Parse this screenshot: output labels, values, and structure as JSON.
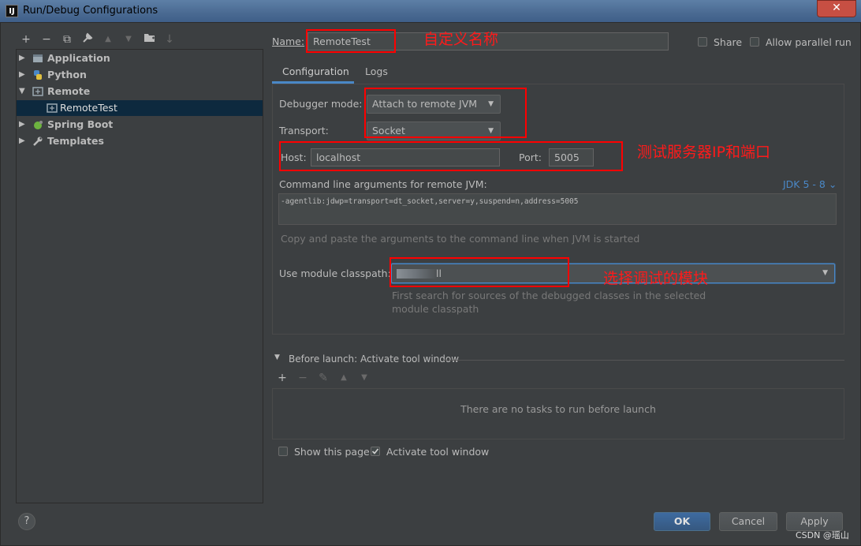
{
  "window": {
    "app_icon": "IJ",
    "title": "Run/Debug Configurations",
    "close_glyph": "✕"
  },
  "toolbar": {
    "add": "+",
    "remove": "−",
    "copy": "⧉",
    "edit": "🔧",
    "up": "▲",
    "down": "▼",
    "folder": "📁",
    "sort": "↓"
  },
  "tree": {
    "items": [
      {
        "label": "Application",
        "icon": "application-icon",
        "expanded": false
      },
      {
        "label": "Python",
        "icon": "python-icon",
        "expanded": false
      },
      {
        "label": "Remote",
        "icon": "remote-icon",
        "expanded": true
      },
      {
        "label": "RemoteTest",
        "icon": "remote-config-icon",
        "selected": true
      },
      {
        "label": "Spring Boot",
        "icon": "spring-boot-icon",
        "expanded": false
      },
      {
        "label": "Templates",
        "icon": "wrench-icon",
        "expanded": false
      }
    ]
  },
  "name": {
    "label": "Name:",
    "value": "RemoteTest"
  },
  "share": {
    "label": "Share",
    "checked": false
  },
  "allow_parallel": {
    "label": "Allow parallel run",
    "checked": false
  },
  "tabs": [
    {
      "label": "Configuration",
      "active": true
    },
    {
      "label": "Logs",
      "active": false
    }
  ],
  "config": {
    "debugger_mode_label": "Debugger mode:",
    "debugger_mode_value": "Attach to remote JVM",
    "transport_label": "Transport:",
    "transport_value": "Socket",
    "host_label": "Host:",
    "host_value": "localhost",
    "port_label": "Port:",
    "port_value": "5005",
    "cmd_label": "Command line arguments for remote JVM:",
    "jdk_value": "JDK 5 - 8 ⌄",
    "cmd_value": "-agentlib:jdwp=transport=dt_socket,server=y,suspend=n,address=5005",
    "cmd_hint": "Copy and paste the arguments to the command line when JVM is started",
    "module_label": "Use module classpath:",
    "module_value": "ll",
    "module_hint_1": "First search for sources of the debugged classes in the selected",
    "module_hint_2": "module classpath"
  },
  "before_launch": {
    "title": "Before launch: Activate tool window",
    "add": "+",
    "remove": "−",
    "edit": "✎",
    "up": "▲",
    "down": "▼",
    "empty_text": "There are no tasks to run before launch"
  },
  "show_page": {
    "label": "Show this page",
    "checked": false
  },
  "activate_tool": {
    "label": "Activate tool window",
    "checked": true
  },
  "annotations": {
    "name_note": "自定义名称",
    "host_note": "测试服务器IP和端口",
    "module_note": "选择调试的模块"
  },
  "buttons": {
    "help": "?",
    "ok": "OK",
    "cancel": "Cancel",
    "apply": "Apply"
  },
  "watermark": "CSDN @瑶山",
  "colors": {
    "accent": "#4a88c7",
    "annotation": "#ff0000",
    "selection": "#0d293e"
  }
}
